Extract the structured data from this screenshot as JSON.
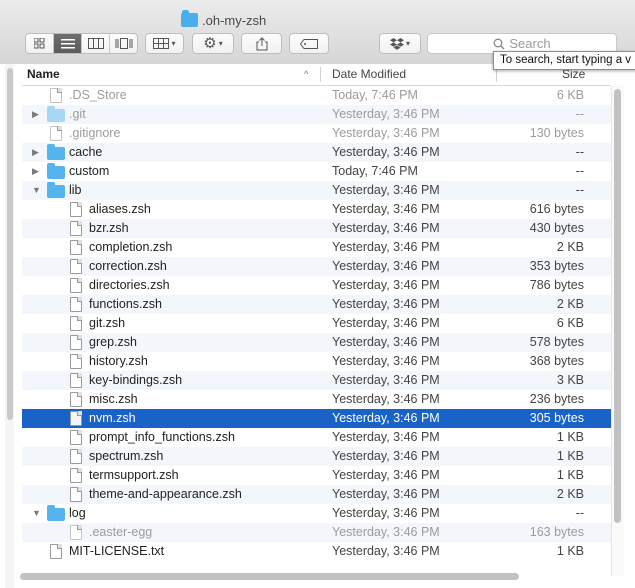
{
  "window": {
    "title": ".oh-my-zsh"
  },
  "toolbar": {
    "search_placeholder": "Search",
    "search_tooltip": "To search, start typing a v"
  },
  "columns": {
    "name": "Name",
    "date": "Date Modified",
    "size": "Size",
    "sort_indicator": "^"
  },
  "rows": [
    {
      "name": ".DS_Store",
      "date": "Today, 7:46 PM",
      "size": "6 KB",
      "kind": "file",
      "depth": 0,
      "dim": true,
      "disclosure": ""
    },
    {
      "name": ".git",
      "date": "Yesterday, 3:46 PM",
      "size": "--",
      "kind": "folder",
      "depth": 0,
      "dim": true,
      "disclosure": "▶"
    },
    {
      "name": ".gitignore",
      "date": "Yesterday, 3:46 PM",
      "size": "130 bytes",
      "kind": "file",
      "depth": 0,
      "dim": true,
      "disclosure": ""
    },
    {
      "name": "cache",
      "date": "Yesterday, 3:46 PM",
      "size": "--",
      "kind": "folder",
      "depth": 0,
      "dim": false,
      "disclosure": "▶"
    },
    {
      "name": "custom",
      "date": "Today, 7:46 PM",
      "size": "--",
      "kind": "folder",
      "depth": 0,
      "dim": false,
      "disclosure": "▶"
    },
    {
      "name": "lib",
      "date": "Yesterday, 3:46 PM",
      "size": "--",
      "kind": "folder",
      "depth": 0,
      "dim": false,
      "disclosure": "▼"
    },
    {
      "name": "aliases.zsh",
      "date": "Yesterday, 3:46 PM",
      "size": "616 bytes",
      "kind": "file",
      "depth": 1,
      "dim": false,
      "disclosure": ""
    },
    {
      "name": "bzr.zsh",
      "date": "Yesterday, 3:46 PM",
      "size": "430 bytes",
      "kind": "file",
      "depth": 1,
      "dim": false,
      "disclosure": ""
    },
    {
      "name": "completion.zsh",
      "date": "Yesterday, 3:46 PM",
      "size": "2 KB",
      "kind": "file",
      "depth": 1,
      "dim": false,
      "disclosure": ""
    },
    {
      "name": "correction.zsh",
      "date": "Yesterday, 3:46 PM",
      "size": "353 bytes",
      "kind": "file",
      "depth": 1,
      "dim": false,
      "disclosure": ""
    },
    {
      "name": "directories.zsh",
      "date": "Yesterday, 3:46 PM",
      "size": "786 bytes",
      "kind": "file",
      "depth": 1,
      "dim": false,
      "disclosure": ""
    },
    {
      "name": "functions.zsh",
      "date": "Yesterday, 3:46 PM",
      "size": "2 KB",
      "kind": "file",
      "depth": 1,
      "dim": false,
      "disclosure": ""
    },
    {
      "name": "git.zsh",
      "date": "Yesterday, 3:46 PM",
      "size": "6 KB",
      "kind": "file",
      "depth": 1,
      "dim": false,
      "disclosure": ""
    },
    {
      "name": "grep.zsh",
      "date": "Yesterday, 3:46 PM",
      "size": "578 bytes",
      "kind": "file",
      "depth": 1,
      "dim": false,
      "disclosure": ""
    },
    {
      "name": "history.zsh",
      "date": "Yesterday, 3:46 PM",
      "size": "368 bytes",
      "kind": "file",
      "depth": 1,
      "dim": false,
      "disclosure": ""
    },
    {
      "name": "key-bindings.zsh",
      "date": "Yesterday, 3:46 PM",
      "size": "3 KB",
      "kind": "file",
      "depth": 1,
      "dim": false,
      "disclosure": ""
    },
    {
      "name": "misc.zsh",
      "date": "Yesterday, 3:46 PM",
      "size": "236 bytes",
      "kind": "file",
      "depth": 1,
      "dim": false,
      "disclosure": ""
    },
    {
      "name": "nvm.zsh",
      "date": "Yesterday, 3:46 PM",
      "size": "305 bytes",
      "kind": "file",
      "depth": 1,
      "dim": false,
      "disclosure": "",
      "selected": true
    },
    {
      "name": "prompt_info_functions.zsh",
      "date": "Yesterday, 3:46 PM",
      "size": "1 KB",
      "kind": "file",
      "depth": 1,
      "dim": false,
      "disclosure": ""
    },
    {
      "name": "spectrum.zsh",
      "date": "Yesterday, 3:46 PM",
      "size": "1 KB",
      "kind": "file",
      "depth": 1,
      "dim": false,
      "disclosure": ""
    },
    {
      "name": "termsupport.zsh",
      "date": "Yesterday, 3:46 PM",
      "size": "1 KB",
      "kind": "file",
      "depth": 1,
      "dim": false,
      "disclosure": ""
    },
    {
      "name": "theme-and-appearance.zsh",
      "date": "Yesterday, 3:46 PM",
      "size": "2 KB",
      "kind": "file",
      "depth": 1,
      "dim": false,
      "disclosure": ""
    },
    {
      "name": "log",
      "date": "Yesterday, 3:46 PM",
      "size": "--",
      "kind": "folder",
      "depth": 0,
      "dim": false,
      "disclosure": "▼"
    },
    {
      "name": ".easter-egg",
      "date": "Yesterday, 3:46 PM",
      "size": "163 bytes",
      "kind": "file",
      "depth": 1,
      "dim": true,
      "disclosure": ""
    },
    {
      "name": "MIT-LICENSE.txt",
      "date": "Yesterday, 3:46 PM",
      "size": "1 KB",
      "kind": "file",
      "depth": 0,
      "dim": false,
      "disclosure": ""
    }
  ],
  "colors": {
    "selection": "#1962c8",
    "folder": "#53b4ee",
    "alt_row": "#f3f6fa"
  },
  "icons": {
    "view_icon": "icon-view-icon",
    "view_list": "list-view-icon",
    "view_columns": "column-view-icon",
    "view_coverflow": "cover-flow-icon",
    "arrange": "arrange-grid-icon",
    "action": "gear-icon",
    "share": "share-icon",
    "tag": "tag-icon",
    "dropbox": "dropbox-icon",
    "search": "search-icon"
  }
}
